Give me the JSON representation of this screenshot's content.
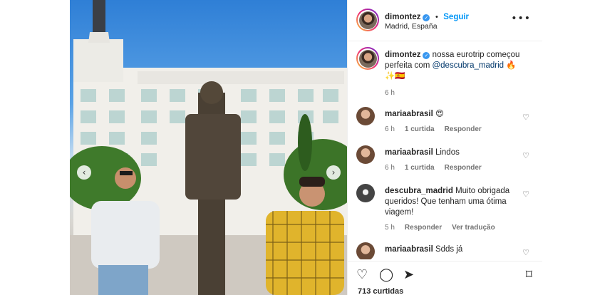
{
  "post": {
    "author": "dimontez",
    "follow_label": "Seguir",
    "location": "Madrid, España",
    "more_icon": "more-options-icon"
  },
  "caption": {
    "username": "dimontez",
    "text_before": " nossa eurotrip começou perfeita com ",
    "mention": "@descubra_madrid",
    "emoji": " 🔥 ✨🇪🇸",
    "time": "6 h"
  },
  "comments": [
    {
      "username": "mariaabrasil",
      "text": " 😍",
      "time": "6 h",
      "likes": "1 curtida",
      "reply": "Responder"
    },
    {
      "username": "mariaabrasil",
      "text": " Lindos",
      "time": "6 h",
      "likes": "1 curtida",
      "reply": "Responder"
    },
    {
      "username": "descubra_madrid",
      "text": " Muito obrigada queridos! Que tenham uma ótima viagem!",
      "time": "5 h",
      "reply": "Responder",
      "translation": "Ver tradução"
    },
    {
      "username": "mariaabrasil",
      "text": " Sdds já"
    }
  ],
  "actions": {
    "like_icon": "heart-icon",
    "comment_icon": "comment-icon",
    "share_icon": "share-icon",
    "save_icon": "bookmark-icon",
    "likes_count": "713 curtidas"
  },
  "colors": {
    "link": "#0095f6",
    "mention": "#00376b",
    "muted": "#737373",
    "verified": "#3897f0"
  }
}
